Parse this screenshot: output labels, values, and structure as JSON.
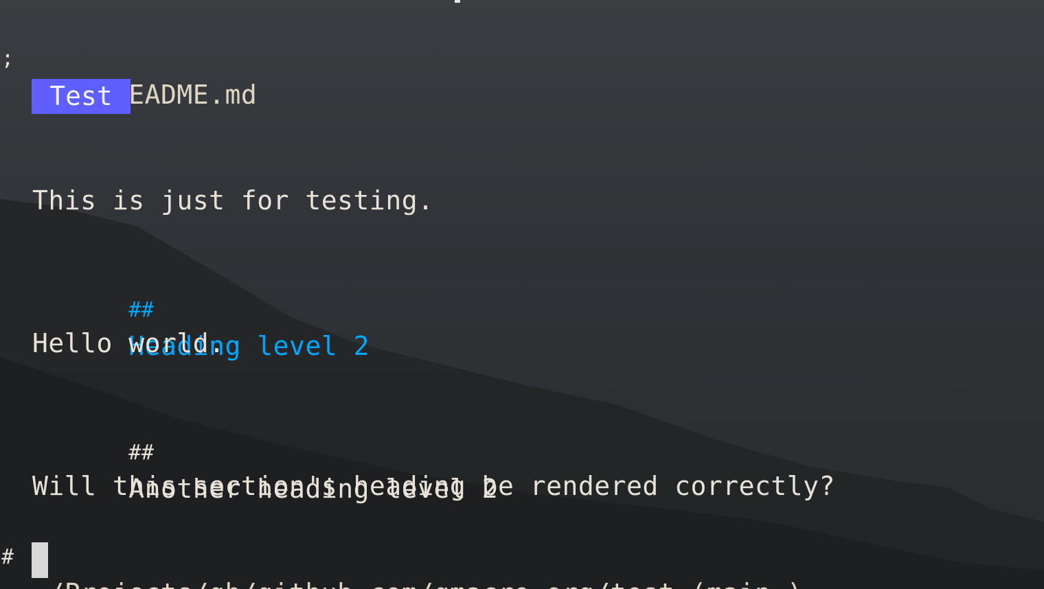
{
  "terminal": {
    "prompt_symbol": ";",
    "command": "glow README.md",
    "document": {
      "title": "Test",
      "paragraph_1": "This is just for testing.",
      "heading_1": {
        "marker": "##",
        "text": "Heading level 2"
      },
      "paragraph_2": "Hello world.",
      "heading_2": {
        "marker": "##",
        "text": "Another heading level 2"
      },
      "paragraph_3": "Will this section's heading be rendered correctly?"
    },
    "status_line": {
      "marker": "#",
      "path": "~/Projects/gh/github.com/qmacro-org/test (main=)"
    },
    "input_prompt_symbol": ";"
  },
  "colors": {
    "title_badge_bg": "#5f5fff",
    "heading_accent": "#00a8ff",
    "text": "#e8e2d8",
    "background": "#2f3236"
  }
}
